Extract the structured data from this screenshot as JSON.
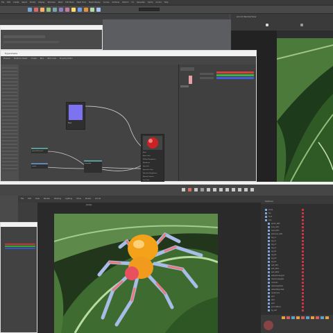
{
  "top_app": {
    "menu": [
      "File",
      "Edit",
      "Create",
      "Select",
      "Modify",
      "Display",
      "Windows",
      "Mesh",
      "Edit Mesh",
      "Mesh Tools",
      "Mesh Display",
      "Curves",
      "Surfaces",
      "Deform",
      "UV",
      "Generate",
      "Cache",
      "Arnold",
      "Help"
    ],
    "toolbar_icon_colors": [
      "#6fa8dc",
      "#e06666",
      "#f6b26b",
      "#93c47d",
      "#76a5af",
      "#8e7cc3",
      "#c27ba0",
      "#ffd966",
      "#6d9eeb",
      "#e69138",
      "#b6d7a8",
      "#a4c2f4"
    ],
    "render_view_title": "Arnold RenderView"
  },
  "hypershade": {
    "title": "Hypershade",
    "tabs": [
      "Browser",
      "Material Viewer",
      "Create",
      "Bins",
      "Work Area",
      "Property Editor"
    ],
    "nodes": {
      "texture": "file1",
      "shader": "aiStandardSurface1",
      "place2d": "place2dTexture1",
      "bump": "bump2d1",
      "ramp": "ramp1"
    },
    "shader_attrs": [
      "Base",
      "Base Color",
      "Diffuse Roughness",
      "Metalness",
      "Specular",
      "Specular Color",
      "Specular Roughness",
      "Normal Camera",
      "Out Color"
    ],
    "properties": {
      "base_color": "#e8a0a8",
      "channels": [
        {
          "name": "R",
          "color": "#d84040"
        },
        {
          "name": "G",
          "color": "#40b040"
        },
        {
          "name": "B",
          "color": "#4060d8"
        }
      ]
    }
  },
  "bottom_app": {
    "menu": [
      "File",
      "Edit",
      "View",
      "Render",
      "Shading",
      "Lighting",
      "Show",
      "Panels",
      "Arnold"
    ],
    "viewport_label": "persp",
    "outliner_title": "Outliner",
    "outliner_items": [
      "persp",
      "top",
      "front",
      "side",
      "spider_GRP",
      "body_GEO",
      "head_GEO",
      "abdomen_GEO",
      "leg_L1",
      "leg_L2",
      "leg_L3",
      "leg_L4",
      "leg_R1",
      "leg_R2",
      "leg_R3",
      "leg_R4",
      "leaf_GEO",
      "leaf_GEO1",
      "leaf_GEO2",
      "aiSkyDomeLight1",
      "directionalLight1",
      "camera1",
      "defaultLightSet",
      "defaultObjectSet",
      "renderCam",
      "set1",
      "set2",
      "set3",
      "groundPlane",
      "bg_leaf"
    ],
    "left_panel_channels": [
      {
        "name": "R",
        "color": "#cc3333"
      },
      {
        "name": "G",
        "color": "#33aa33"
      },
      {
        "name": "B",
        "color": "#3355cc"
      }
    ]
  }
}
